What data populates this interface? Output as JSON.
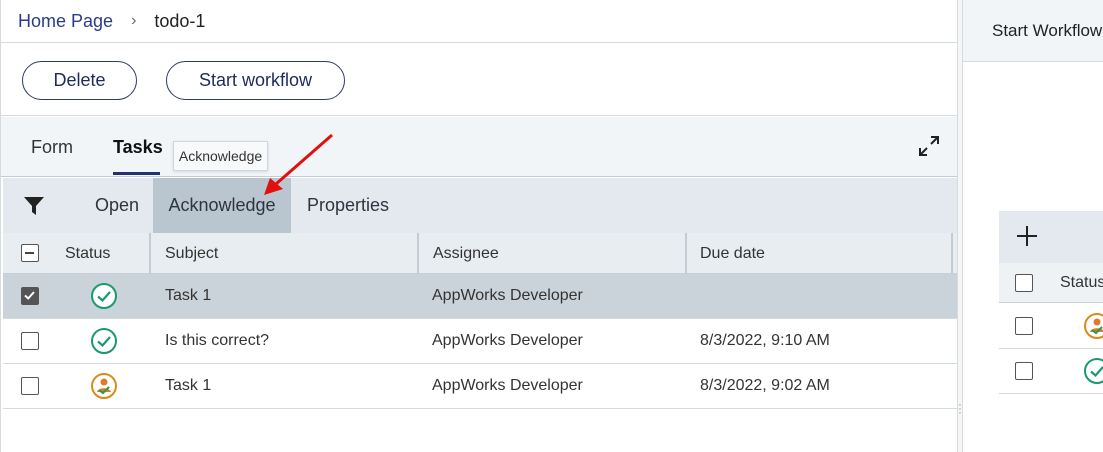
{
  "breadcrumb": {
    "home": "Home Page",
    "current": "todo-1"
  },
  "actions": {
    "delete_label": "Delete",
    "start_label": "Start workflow"
  },
  "tabs": [
    {
      "label": "Form"
    },
    {
      "label": "Tasks"
    }
  ],
  "tooltip": "Acknowledge",
  "toolbar": {
    "open_label": "Open",
    "acknowledge_label": "Acknowledge",
    "properties_label": "Properties"
  },
  "table": {
    "columns": [
      "Status",
      "Subject",
      "Assignee",
      "Due date"
    ],
    "rows": [
      {
        "status": "completed-icon",
        "subject": "Task 1",
        "assignee": "AppWorks Developer",
        "due": "",
        "checked": true
      },
      {
        "status": "completed-icon",
        "subject": "Is this correct?",
        "assignee": "AppWorks Developer",
        "due": "8/3/2022, 9:10 AM",
        "checked": false
      },
      {
        "status": "assigned-user-icon",
        "subject": "Task 1",
        "assignee": "AppWorks Developer",
        "due": "8/3/2022, 9:02 AM",
        "checked": false
      }
    ]
  },
  "right_panel": {
    "title": "Start Workflow",
    "status_header": "Status"
  },
  "colors": {
    "accent": "#23336e",
    "success": "#1a9a6c",
    "selected_row": "#cad3da",
    "annotation_arrow": "#e01010"
  }
}
